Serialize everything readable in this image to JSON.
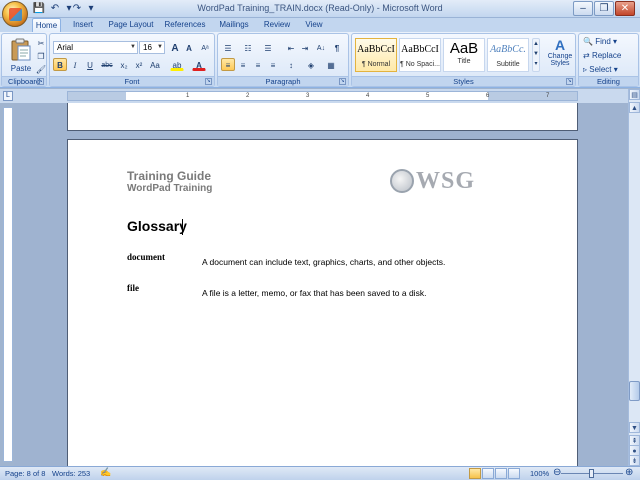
{
  "window": {
    "title": "WordPad Training_TRAIN.docx (Read-Only) - Microsoft Word",
    "controls": {
      "minimize": "‒",
      "restore": "❐",
      "close": "✕"
    }
  },
  "quick_access": {
    "save_icon": "save-icon",
    "undo_icon": "undo-icon",
    "redo_icon": "redo-icon"
  },
  "tabs": [
    "Home",
    "Insert",
    "Page Layout",
    "References",
    "Mailings",
    "Review",
    "View"
  ],
  "active_tab": "Home",
  "ribbon": {
    "clipboard": {
      "label": "Clipboard",
      "paste_label": "Paste",
      "cut": "✂",
      "copy": "❐",
      "format_painter": "🖌"
    },
    "font": {
      "label": "Font",
      "font_name": "Arial",
      "font_size": "16",
      "grow": "A",
      "shrink": "A",
      "clear": "Aᵃ",
      "bold": "B",
      "italic": "I",
      "underline": "U",
      "strikethrough": "abc",
      "subscript": "x₂",
      "superscript": "x²",
      "change_case": "Aa",
      "highlight": "ab",
      "font_color": "A"
    },
    "paragraph": {
      "label": "Paragraph",
      "bullets": "☰",
      "numbering": "☷",
      "multilevel": "☰",
      "decrease_indent": "⇤",
      "increase_indent": "⇥",
      "sort": "A↓",
      "show_marks": "¶",
      "align_left": "≡",
      "center": "≡",
      "align_right": "≡",
      "justify": "≡",
      "line_spacing": "↕",
      "shading": "◈",
      "borders": "▦"
    },
    "styles": {
      "label": "Styles",
      "items": [
        {
          "preview": "AaBbCcI",
          "name": "¶ Normal"
        },
        {
          "preview": "AaBbCcI",
          "name": "¶ No Spaci..."
        },
        {
          "preview": "AaB",
          "name": "Title"
        },
        {
          "preview": "AaBbCc.",
          "name": "Subtitle"
        }
      ],
      "change_styles": "Change Styles"
    },
    "editing": {
      "label": "Editing",
      "find": "Find",
      "replace": "Replace",
      "select": "Select"
    }
  },
  "ruler": {
    "ticks": [
      "1",
      "2",
      "3",
      "4",
      "5",
      "6",
      "7"
    ]
  },
  "document": {
    "header_title": "Training Guide",
    "header_subtitle": "WordPad Training",
    "logo_text": "WSG",
    "heading": "Glossary",
    "entries": [
      {
        "term": "document",
        "definition": "A document can include text, graphics, charts, and other objects."
      },
      {
        "term": "file",
        "definition": "A file is a letter, memo, or fax that has been saved to a disk."
      }
    ]
  },
  "status": {
    "page": "Page: 8 of 8",
    "words": "Words: 253",
    "zoom": "100%"
  }
}
